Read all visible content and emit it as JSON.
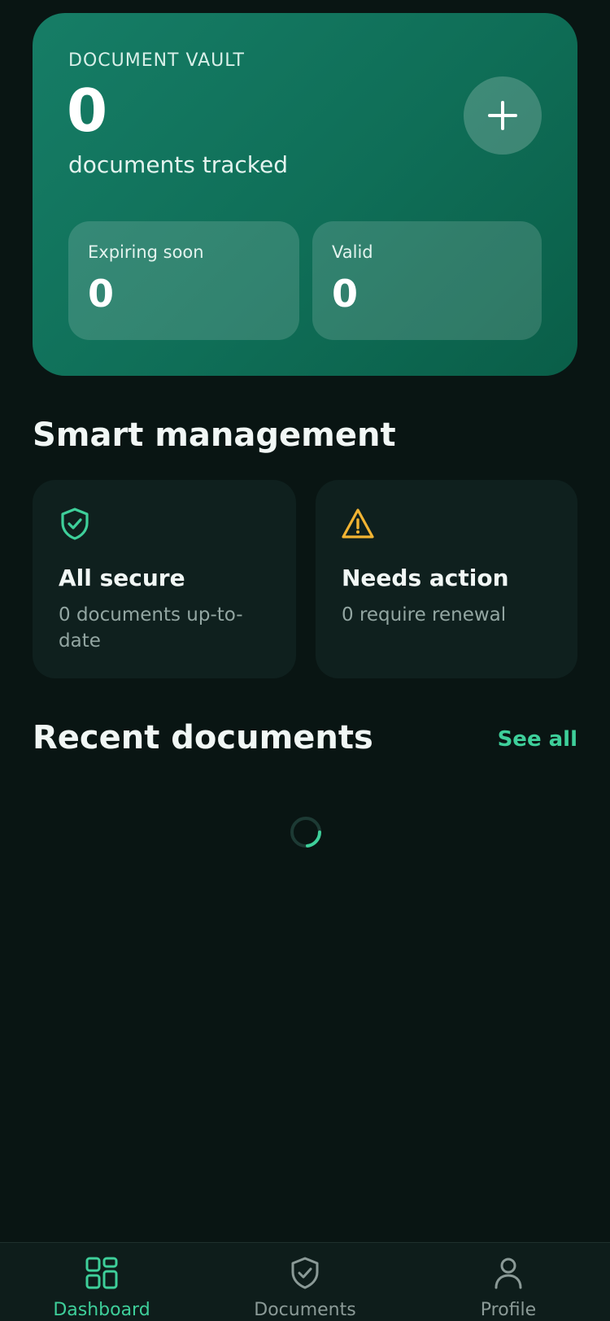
{
  "hero": {
    "title": "DOCUMENT VAULT",
    "count": "0",
    "subtitle": "documents tracked",
    "add_icon": "plus-icon",
    "stats": [
      {
        "label": "Expiring soon",
        "value": "0"
      },
      {
        "label": "Valid",
        "value": "0"
      }
    ]
  },
  "smart_management": {
    "title": "Smart management",
    "tiles": [
      {
        "icon": "shield-check-icon",
        "title": "All secure",
        "desc": "0 documents up-to-date"
      },
      {
        "icon": "warning-triangle-icon",
        "title": "Needs action",
        "desc": "0 require renewal"
      }
    ]
  },
  "recent": {
    "title": "Recent documents",
    "see_all": "See all"
  },
  "nav": {
    "items": [
      {
        "label": "Dashboard",
        "icon": "grid-icon",
        "active": true
      },
      {
        "label": "Documents",
        "icon": "shield-check-icon",
        "active": false
      },
      {
        "label": "Profile",
        "icon": "person-icon",
        "active": false
      }
    ]
  },
  "colors": {
    "background": "#091513",
    "accent": "#3ecf9a",
    "card": "#0f201e",
    "hero": "#117560",
    "warning": "#f2b433"
  }
}
